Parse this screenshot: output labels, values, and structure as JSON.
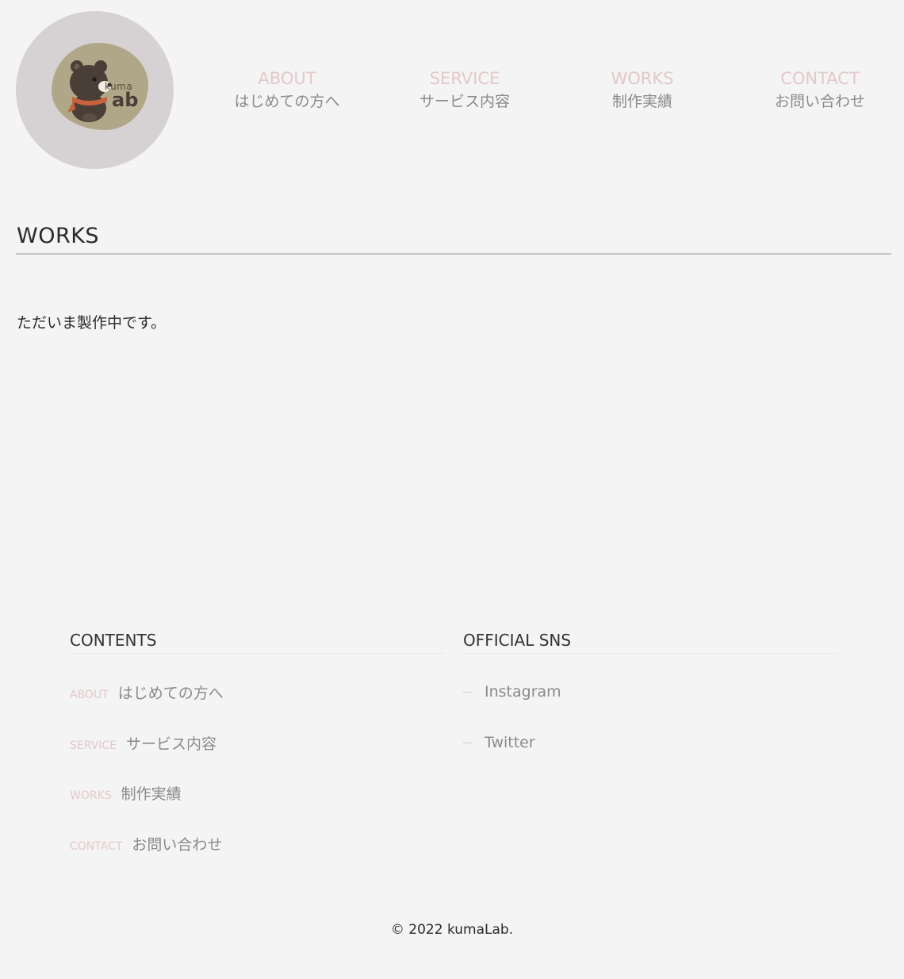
{
  "brand": {
    "logo_word_small": "kuma",
    "logo_word_large": "ab",
    "logo_circle_color": "#d6d2d3",
    "logo_blob_color": "#b0a688"
  },
  "nav": {
    "items": [
      {
        "en": "ABOUT",
        "jp": "はじめての方へ"
      },
      {
        "en": "SERVICE",
        "jp": "サービス内容"
      },
      {
        "en": "WORKS",
        "jp": "制作実績"
      },
      {
        "en": "CONTACT",
        "jp": "お問い合わせ"
      }
    ]
  },
  "main": {
    "title": "WORKS",
    "message": "ただいま製作中です。"
  },
  "footer": {
    "contents_heading": "CONTENTS",
    "sns_heading": "OFFICIAL SNS",
    "links": [
      {
        "en": "ABOUT",
        "jp": "はじめての方へ"
      },
      {
        "en": "SERVICE",
        "jp": "サービス内容"
      },
      {
        "en": "WORKS",
        "jp": "制作実績"
      },
      {
        "en": "CONTACT",
        "jp": "お問い合わせ"
      }
    ],
    "sns": [
      {
        "label": "Instagram"
      },
      {
        "label": "Twitter"
      }
    ],
    "copyright": "© 2022 kumaLab."
  },
  "colors": {
    "background": "#f4f4f4",
    "accent_pink": "#e3c8ca",
    "muted_text": "#8a8a8a",
    "dark_text": "#2a2a2a"
  }
}
